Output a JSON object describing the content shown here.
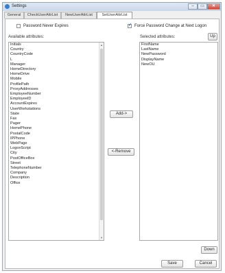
{
  "window": {
    "title": "Settings",
    "min_symbol": "–",
    "max_symbol": "▭",
    "close_symbol": "✕"
  },
  "tabs": [
    {
      "label": "General"
    },
    {
      "label": "CheckUserAttrList"
    },
    {
      "label": "NewUserAttrList"
    },
    {
      "label": "SetUserAttrList",
      "selected": true
    }
  ],
  "options": {
    "password_never_expires": {
      "label": "Password Never Expires",
      "checked": false
    },
    "force_password_change": {
      "label": "Force Password Change at Next Logon",
      "checked": true
    }
  },
  "available": {
    "label": "Available attributes:",
    "items": [
      "Initials",
      "Country",
      "CountryCode",
      "L",
      "Manager",
      "HomeDirectory",
      "HomeDrive",
      "Mobile",
      "ProfilePath",
      "ProxyAddresses",
      "EmployeeNumber",
      "EmployeeID",
      "AccountExpires",
      "UserWorkstations",
      "State",
      "Fax",
      "Pager",
      "HomePhone",
      "PostalCode",
      "IPPhone",
      "WebPage",
      "LogonScript",
      "City",
      "PostOfficeBox",
      "Street",
      "TelephoneNumber",
      "Company",
      "Description",
      "Office"
    ]
  },
  "selected": {
    "label": "Selected attributes:",
    "items": [
      "FirstName",
      "LastName",
      "NewPassword",
      "DisplayName",
      "NewOU"
    ]
  },
  "buttons": {
    "add": "Add->",
    "remove": "<-Remove",
    "up": "Up",
    "down": "Down",
    "save": "Save",
    "cancel": "Cancel"
  },
  "icons": {
    "scroll_up": "▲",
    "scroll_down": "▼"
  }
}
